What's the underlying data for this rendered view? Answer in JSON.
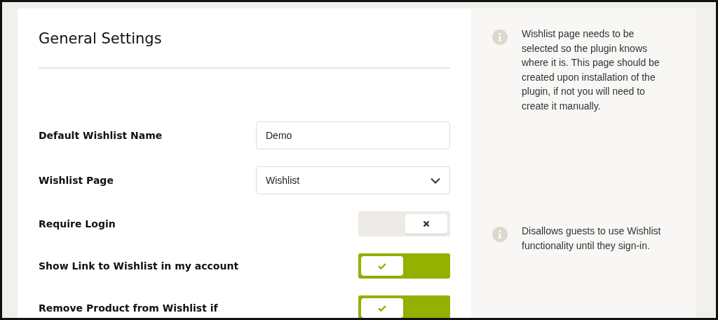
{
  "heading": "General Settings",
  "fields": [
    {
      "kind": "text",
      "label": "Default Wishlist Name",
      "value": "Demo"
    },
    {
      "kind": "select",
      "label": "Wishlist Page",
      "value": "Wishlist"
    },
    {
      "kind": "toggle",
      "label": "Require Login",
      "on": false
    },
    {
      "kind": "toggle",
      "label": "Show Link to Wishlist in my account",
      "on": true
    },
    {
      "kind": "toggle",
      "label": "Remove Product from Wishlist if",
      "on": true
    }
  ],
  "notes": [
    "Wishlist page needs to be selected so the plugin knows where it is. This page should be created upon installation of the plugin, if not you will need to create it manually.",
    "Disallows guests to use Wishlist functionality until they sign-in."
  ]
}
